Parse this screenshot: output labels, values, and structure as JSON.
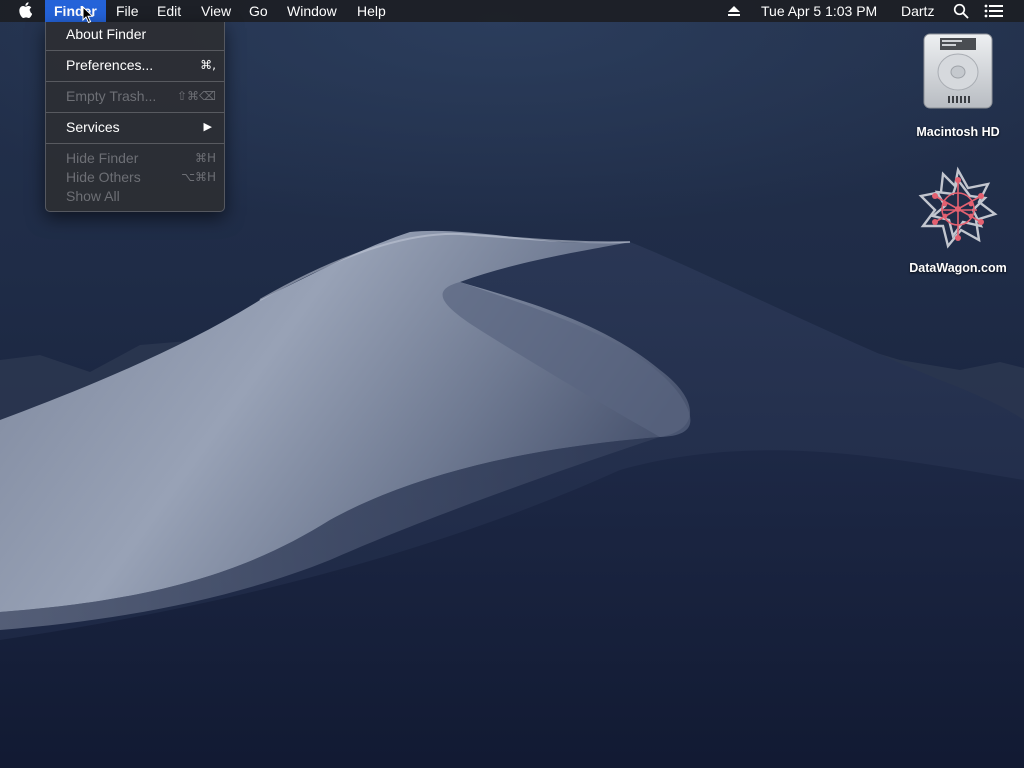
{
  "menubar": {
    "apple_icon": "apple-icon",
    "app_name": "Finder",
    "menus": [
      "File",
      "Edit",
      "View",
      "Go",
      "Window",
      "Help"
    ],
    "datetime": "Tue Apr 5  1:03 PM",
    "user": "Dartz",
    "status_icons": [
      "eject-icon",
      "search-icon",
      "list-icon"
    ]
  },
  "finder_menu": {
    "about": "About Finder",
    "preferences": {
      "label": "Preferences...",
      "shortcut": "⌘,"
    },
    "empty_trash": {
      "label": "Empty Trash...",
      "shortcut": "⇧⌘⌫"
    },
    "services": {
      "label": "Services"
    },
    "hide_finder": {
      "label": "Hide Finder",
      "shortcut": "⌘H"
    },
    "hide_others": {
      "label": "Hide Others",
      "shortcut": "⌥⌘H"
    },
    "show_all": {
      "label": "Show All"
    }
  },
  "desktop_icons": [
    {
      "label": "Macintosh HD",
      "icon": "hard-drive-icon"
    },
    {
      "label": "DataWagon.com",
      "icon": "datawagon-logo-icon"
    }
  ],
  "colors": {
    "menu_highlight": "#2463d9",
    "sky": "#1f2c47"
  }
}
